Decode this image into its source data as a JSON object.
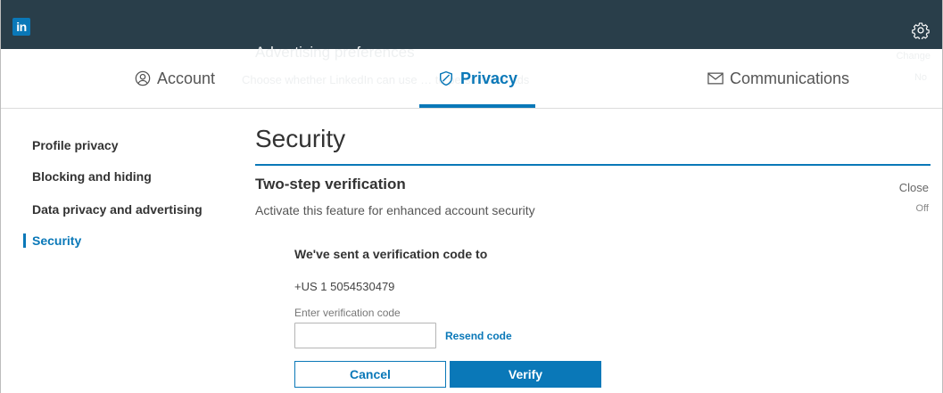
{
  "app": {
    "logo_text": "in"
  },
  "header": {
    "settings_icon": "gear-icon"
  },
  "background_text": {
    "title": "Advertising preferences",
    "subtitle": "Choose whether LinkedIn can use … to personalize ads",
    "right_1": "Change",
    "right_2": "No"
  },
  "tabs": [
    {
      "label": "Account",
      "icon": "person-circle-icon",
      "active": false
    },
    {
      "label": "Privacy",
      "icon": "shield-icon",
      "active": true
    },
    {
      "label": "Communications",
      "icon": "envelope-icon",
      "active": false
    }
  ],
  "sidebar": {
    "items": [
      {
        "label": "Profile privacy",
        "active": false
      },
      {
        "label": "Blocking and hiding",
        "active": false
      },
      {
        "label": "Data privacy and advertising",
        "active": false
      },
      {
        "label": "Security",
        "active": true
      }
    ]
  },
  "main": {
    "title": "Security",
    "section": {
      "title": "Two-step verification",
      "description": "Activate this feature for enhanced account security",
      "close_label": "Close",
      "status": "Off"
    },
    "verification": {
      "sent_label": "We've sent a verification code to",
      "phone": "+US 1 5054530479",
      "code_label": "Enter verification code",
      "code_value": "",
      "resend_label": "Resend code",
      "cancel_label": "Cancel",
      "verify_label": "Verify"
    }
  },
  "colors": {
    "brand": "#0a78b8",
    "topbar": "#293e4a"
  }
}
